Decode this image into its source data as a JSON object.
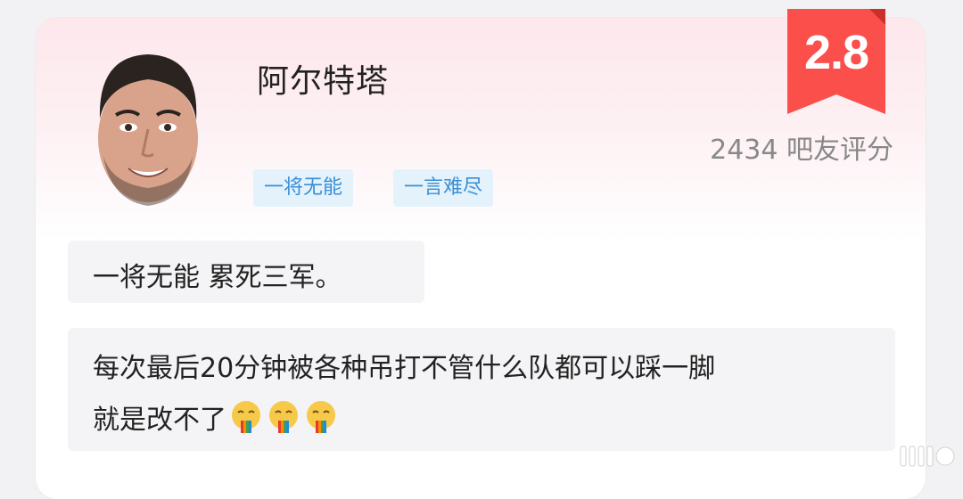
{
  "player": {
    "name": "阿尔特塔",
    "tags": [
      "一将无能",
      "一言难尽"
    ]
  },
  "rating": {
    "score": "2.8",
    "raters": "2434 吧友评分"
  },
  "comments": [
    {
      "text": "一将无能 累死三军。"
    },
    {
      "line1": "每次最后20分钟被各种吊打不管什么队都可以踩一脚",
      "line2": "就是改不了"
    }
  ],
  "icons": {
    "emoji": "vomiting-rainbow-emoji",
    "watermark": "weibo-watermark"
  },
  "colors": {
    "ribbon": "#fb4f4c",
    "tag_bg": "#e4f2fc",
    "tag_text": "#3a8fd6"
  }
}
